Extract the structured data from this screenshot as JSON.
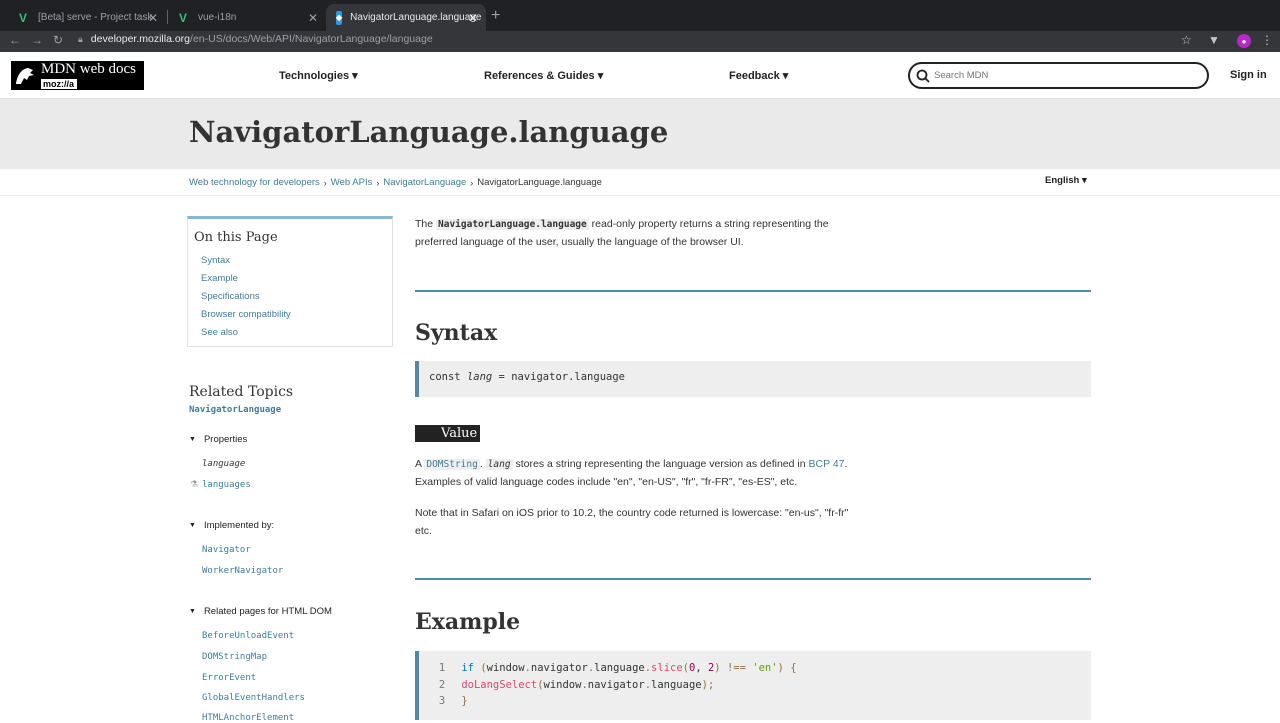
{
  "browser": {
    "tabs": [
      {
        "title": "[Beta] serve - Project tasks - S",
        "icon": "vue-icon"
      },
      {
        "title": "vue-i18n",
        "icon": "vue-icon"
      },
      {
        "title": "NavigatorLanguage.language",
        "icon": "mdn-icon"
      }
    ],
    "url_host": "developer.mozilla.org",
    "url_path": "/en-US/docs/Web/API/NavigatorLanguage/language"
  },
  "header": {
    "logo_title": "MDN web docs",
    "logo_sub": "moz://a",
    "nav": [
      "Technologies ▾",
      "References & Guides ▾",
      "Feedback ▾"
    ],
    "search_placeholder": "Search MDN",
    "signin": "Sign in"
  },
  "page": {
    "title": "NavigatorLanguage.language",
    "breadcrumbs": [
      "Web technology for developers",
      "Web APIs",
      "NavigatorLanguage"
    ],
    "breadcrumb_current": "NavigatorLanguage.language",
    "language": "English ▾"
  },
  "toc": {
    "heading": "On this Page",
    "items": [
      "Syntax",
      "Example",
      "Specifications",
      "Browser compatibility",
      "See also"
    ]
  },
  "related": {
    "heading": "Related Topics",
    "top_link": "NavigatorLanguage",
    "groups": [
      {
        "label": "Properties",
        "items": [
          "language",
          "languages"
        ]
      },
      {
        "label": "Implemented by:",
        "items": [
          "Navigator",
          "WorkerNavigator"
        ]
      },
      {
        "label": "Related pages for HTML DOM",
        "items": [
          "BeforeUnloadEvent",
          "DOMStringMap",
          "ErrorEvent",
          "GlobalEventHandlers",
          "HTMLAnchorElement"
        ]
      }
    ]
  },
  "content": {
    "intro_pre": "The ",
    "intro_code": "NavigatorLanguage.language",
    "intro_post": " read-only property returns a string representing the preferred language of the user, usually the language of the browser UI.",
    "syntax_heading": "Syntax",
    "syntax_code_pre": "const ",
    "syntax_code_var": "lang",
    "syntax_code_post": " = navigator.language",
    "value_badge": "Value",
    "value_p1_pre": "A ",
    "value_p1_code": "DOMString",
    "value_p1_dot": ". ",
    "value_p1_var": "lang",
    "value_p1_mid": " stores a string representing the language version as defined in ",
    "value_p1_link": "BCP 47",
    "value_p1_end": ". Examples of valid language codes include \"en\", \"en-US\", \"fr\", \"fr-FR\", \"es-ES\", etc.",
    "value_p2": "Note that in Safari on iOS prior to 10.2, the country code returned is lowercase: \"en-us\", \"fr-fr\" etc.",
    "example_heading": "Example",
    "example_lines": [
      "1",
      "2",
      "3"
    ]
  }
}
